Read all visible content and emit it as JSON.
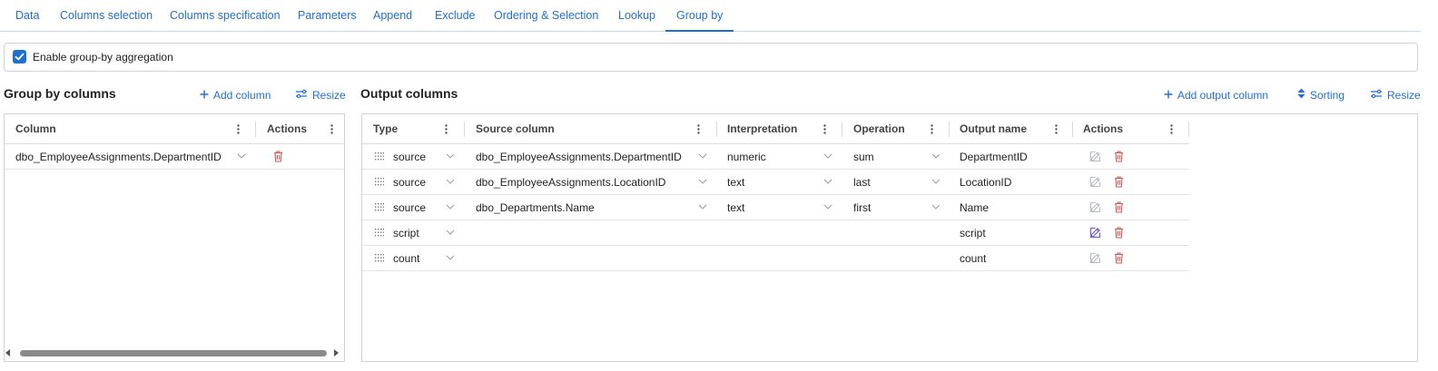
{
  "tabs": [
    {
      "label": "Data"
    },
    {
      "label": "Columns selection"
    },
    {
      "label": "Columns specification"
    },
    {
      "label": "Parameters"
    },
    {
      "label": "Append"
    },
    {
      "label": "Exclude"
    },
    {
      "label": "Ordering & Selection"
    },
    {
      "label": "Lookup"
    },
    {
      "label": "Group by",
      "active": true
    }
  ],
  "enable": {
    "label": "Enable group-by aggregation",
    "checked": true
  },
  "group_by": {
    "title": "Group by columns",
    "add_label": "Add column",
    "resize_label": "Resize",
    "headers": {
      "column": "Column",
      "actions": "Actions"
    },
    "rows": [
      {
        "column": "dbo_EmployeeAssignments.DepartmentID"
      }
    ]
  },
  "output": {
    "title": "Output columns",
    "add_label": "Add output column",
    "sorting_label": "Sorting",
    "resize_label": "Resize",
    "headers": {
      "type": "Type",
      "source": "Source column",
      "interpretation": "Interpretation",
      "operation": "Operation",
      "output_name": "Output name",
      "actions": "Actions"
    },
    "rows": [
      {
        "type": "source",
        "source": "dbo_EmployeeAssignments.DepartmentID",
        "interpretation": "numeric",
        "operation": "sum",
        "output_name": "DepartmentID",
        "edit_active": false
      },
      {
        "type": "source",
        "source": "dbo_EmployeeAssignments.LocationID",
        "interpretation": "text",
        "operation": "last",
        "output_name": "LocationID",
        "edit_active": false
      },
      {
        "type": "source",
        "source": "dbo_Departments.Name",
        "interpretation": "text",
        "operation": "first",
        "output_name": "Name",
        "edit_active": false
      },
      {
        "type": "script",
        "source": "",
        "interpretation": "",
        "operation": "",
        "output_name": "script",
        "edit_active": true
      },
      {
        "type": "count",
        "source": "",
        "interpretation": "",
        "operation": "",
        "output_name": "count",
        "edit_active": false
      }
    ]
  },
  "colors": {
    "accent": "#1f6fd1",
    "delete": "#e05252",
    "edit_active": "#7b5cd6",
    "edit_inactive": "#b8bcc2"
  },
  "icons": {
    "add": "plus-icon",
    "resize": "resize-icon",
    "sorting": "sort-icon",
    "delete": "trash-icon",
    "edit": "pencil-icon",
    "grip": "drag-grip-icon",
    "menu": "kebab-menu-icon",
    "dropdown": "chevron-down-icon"
  }
}
